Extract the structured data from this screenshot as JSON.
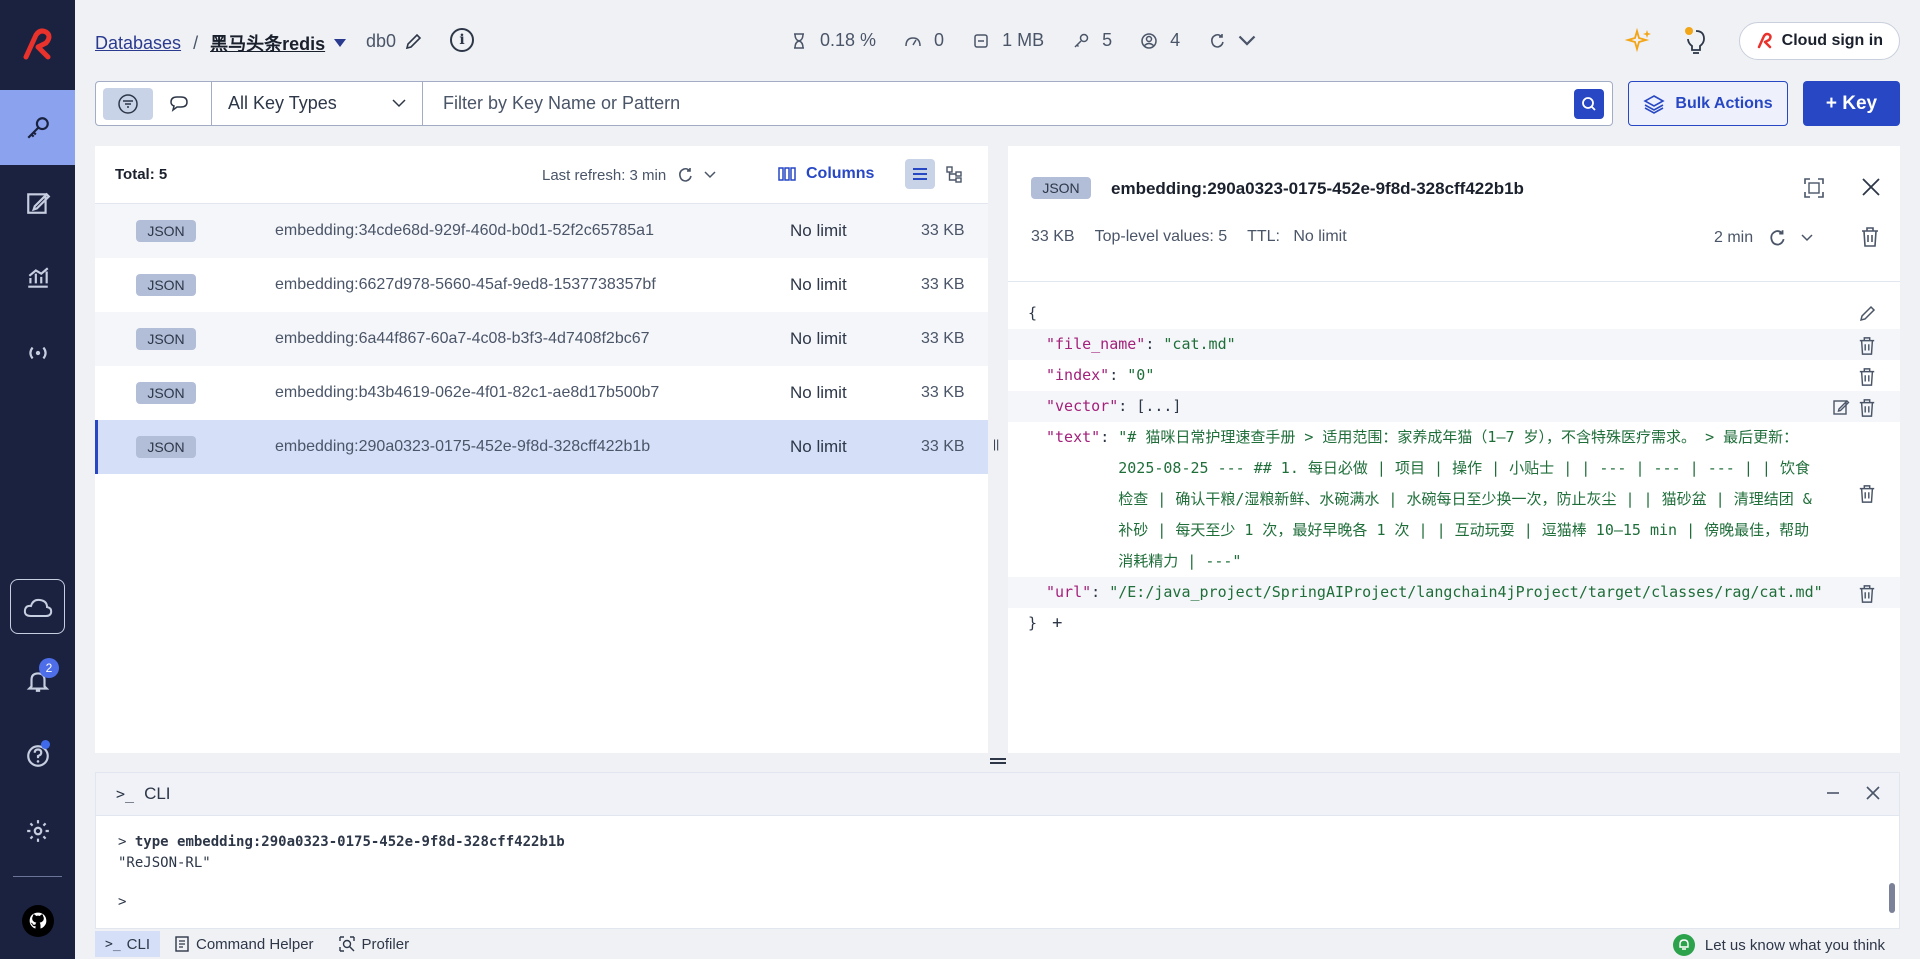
{
  "sidebar": {
    "items": [
      {
        "name": "browser",
        "icon": "key-icon"
      },
      {
        "name": "workbench",
        "icon": "edit-icon"
      },
      {
        "name": "analytics",
        "icon": "chart-icon"
      },
      {
        "name": "pubsub",
        "icon": "broadcast-icon"
      }
    ],
    "notification_count": "2"
  },
  "header": {
    "breadcrumb_databases": "Databases",
    "breadcrumb_separator": "/",
    "database_name": "黑马头条redis",
    "db_index": "db0",
    "stats": {
      "cpu": "0.18 %",
      "ops": "0",
      "memory": "1 MB",
      "keys": "5",
      "clients": "4"
    },
    "cloud_signin": "Cloud sign in"
  },
  "filter": {
    "key_type": "All Key Types",
    "placeholder": "Filter by Key Name or Pattern",
    "bulk_actions": "Bulk Actions",
    "add_key": "+ Key"
  },
  "keylist": {
    "total": "Total: 5",
    "last_refresh": "Last refresh: 3 min",
    "columns": "Columns",
    "rows": [
      {
        "type": "JSON",
        "name": "embedding:34cde68d-929f-460d-b0d1-52f2c65785a1",
        "ttl": "No limit",
        "size": "33 KB"
      },
      {
        "type": "JSON",
        "name": "embedding:6627d978-5660-45af-9ed8-1537738357bf",
        "ttl": "No limit",
        "size": "33 KB"
      },
      {
        "type": "JSON",
        "name": "embedding:6a44f867-60a7-4c08-b3f3-4d7408f2bc67",
        "ttl": "No limit",
        "size": "33 KB"
      },
      {
        "type": "JSON",
        "name": "embedding:b43b4619-062e-4f01-82c1-ae8d17b500b7",
        "ttl": "No limit",
        "size": "33 KB"
      },
      {
        "type": "JSON",
        "name": "embedding:290a0323-0175-452e-9f8d-328cff422b1b",
        "ttl": "No limit",
        "size": "33 KB"
      }
    ]
  },
  "details": {
    "type": "JSON",
    "key": "embedding:290a0323-0175-452e-9f8d-328cff422b1b",
    "size": "33 KB",
    "top_level": "Top-level values: 5",
    "ttl_label": "TTL:",
    "ttl_value": "No limit",
    "refresh": "2 min",
    "json": {
      "open": "{",
      "close": "}",
      "plus": "+",
      "file_name_key": "\"file_name\"",
      "file_name_val": "\"cat.md\"",
      "index_key": "\"index\"",
      "index_val": "\"0\"",
      "vector_key": "\"vector\"",
      "vector_val": "[...]",
      "text_key": "\"text\"",
      "text_val": "\"# 猫咪日常护理速查手册 > 适用范围：家养成年猫（1–7 岁），不含特殊医疗需求。 > 最后更新：2025-08-25 --- ## 1. 每日必做 | 项目 | 操作 | 小贴士 | | --- | --- | --- | | 饮食检查 | 确认干粮/湿粮新鲜、水碗满水 | 水碗每日至少换一次，防止灰尘 | | 猫砂盆 | 清理结团 & 补砂 | 每天至少 1 次，最好早晚各 1 次 | | 互动玩耍 | 逗猫棒 10–15 min | 傍晚最佳，帮助消耗精力 | ---\"",
      "url_key": "\"url\"",
      "url_val": "\"/E:/java_project/SpringAIProject/langchain4jProject/target/classes/rag/cat.md\"",
      "colon": ":"
    }
  },
  "cli": {
    "title": "CLI",
    "prompt": ">",
    "command": "type embedding:290a0323-0175-452e-9f8d-328cff422b1b",
    "response": "\"ReJSON-RL\""
  },
  "footer": {
    "cli": "CLI",
    "command_helper": "Command Helper",
    "profiler": "Profiler",
    "feedback": "Let us know what you think"
  },
  "colors": {
    "sidebar_bg": "#1a2240",
    "accent": "#2747c4",
    "json_key": "#a3207b",
    "json_value": "#1f6e3a",
    "brand_red": "#e8322b"
  }
}
